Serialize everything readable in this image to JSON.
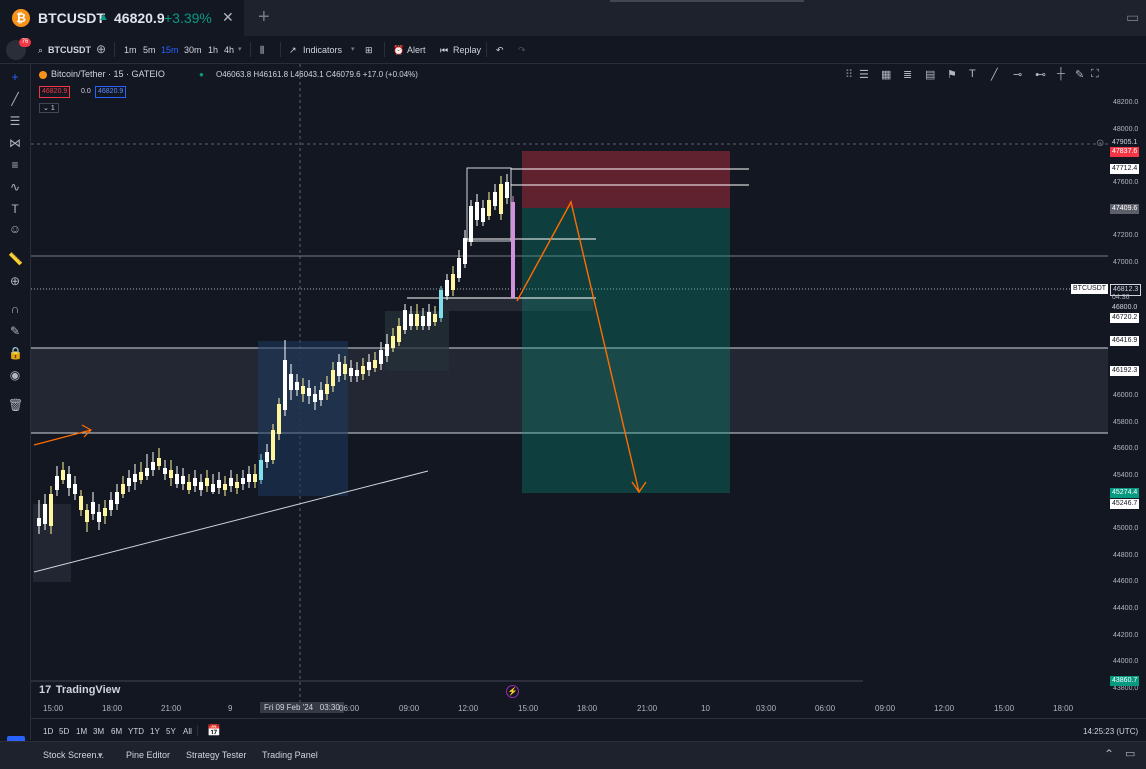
{
  "tab": {
    "symbol": "BTCUSDT",
    "price": "46820.9",
    "change": "+3.39%"
  },
  "toolbar": {
    "badge": "76",
    "symbol": "BTCUSDT",
    "intervals": [
      "1m",
      "5m",
      "15m",
      "30m",
      "1h",
      "4h"
    ],
    "indicators": "Indicators",
    "alert": "Alert",
    "replay": "Replay"
  },
  "legend": {
    "title": "Bitcoin/Tether · 15 · GATEIO",
    "ohlc": "O46063.8 H46161.8 L46043.1 C46079.6 +17.0 (+0.04%)",
    "sell": "46820.9",
    "spread": "0.0",
    "buy": "46820.9",
    "collapse": "1"
  },
  "price_axis": {
    "labels": [
      "48200.0",
      "48000.0",
      "47600.0",
      "47200.0",
      "47000.0",
      "46000.0",
      "45800.0",
      "45600.0",
      "45400.0",
      "45000.0",
      "44800.0",
      "44600.0",
      "44400.0",
      "44200.0",
      "44000.0",
      "43800.0"
    ],
    "tags": {
      "t47905": "47905.1",
      "t47837": "47837.6",
      "t47712": "47712.4",
      "t47409": "47409.6",
      "symbol": "BTCUSDT",
      "t46812": "46812.3",
      "countdown": "04:36",
      "t46800": "46800.0",
      "t46720": "46720.2",
      "t46416": "46416.9",
      "t46192": "46192.3",
      "t45274": "45274.4",
      "t45246": "45246.7",
      "t43860": "43860.7"
    }
  },
  "time_axis": {
    "labels": [
      "15:00",
      "18:00",
      "21:00",
      "9",
      "06:00",
      "09:00",
      "12:00",
      "15:00",
      "18:00",
      "21:00",
      "10",
      "03:00",
      "06:00",
      "09:00",
      "12:00",
      "15:00",
      "18:00"
    ],
    "crosshair": "Fri 09 Feb '24",
    "crosshair_time": "03:30"
  },
  "watermark": "TradingView",
  "ranges": [
    "1D",
    "5D",
    "1M",
    "3M",
    "6M",
    "YTD",
    "1Y",
    "5Y",
    "All"
  ],
  "clock": "14:25:23 (UTC)",
  "panel_tabs": [
    "Stock Screen...",
    "Pine Editor",
    "Strategy Tester",
    "Trading Panel"
  ],
  "colors": {
    "up": "#ffffff",
    "down": "#ffeb3b",
    "accent": "#2962ff",
    "stop_zone": "#f23645",
    "target_zone": "#089981",
    "arrow": "#ff6d00"
  }
}
